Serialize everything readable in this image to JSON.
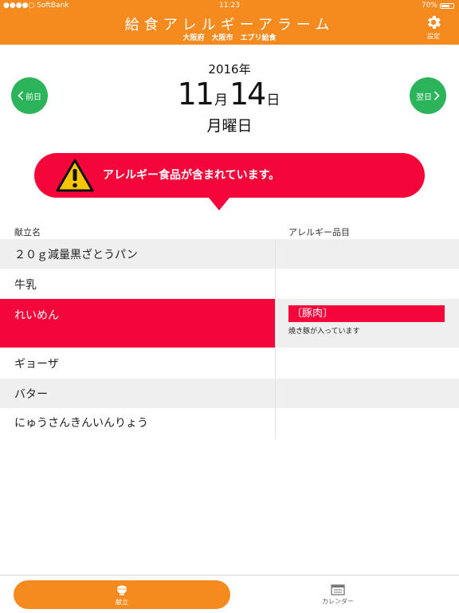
{
  "status_bar": {
    "carrier": "●●●●○ SoftBank",
    "time": "11:23",
    "battery": "70%",
    "battery_level": 0.7
  },
  "header": {
    "title": "給食アレルギーアラーム",
    "subtitle": "大阪府　大阪市　エブリ給食",
    "settings_label": "設定",
    "background": "#f58a1f"
  },
  "date": {
    "year": "2016年",
    "month": "11",
    "month_unit": "月",
    "day": "14",
    "day_unit": "日",
    "weekday": "月曜日",
    "prev_label": "前日",
    "next_label": "翌日",
    "nav_color": "#2bb45a"
  },
  "alert": {
    "message": "アレルギー食品が含まれています。",
    "color": "#f5063a"
  },
  "table": {
    "menu_header": "献立名",
    "allergy_header": "アレルギー品目",
    "rows": [
      {
        "menu": "２０ｇ減量黒ざとうパン",
        "allergy_tag": "",
        "allergy_note": ""
      },
      {
        "menu": "牛乳",
        "allergy_tag": "",
        "allergy_note": ""
      },
      {
        "menu": "れいめん",
        "allergy_tag": "〔豚肉〕",
        "allergy_note": "焼き豚が入っています"
      },
      {
        "menu": "ギョーザ",
        "allergy_tag": "",
        "allergy_note": ""
      },
      {
        "menu": "バター",
        "allergy_tag": "",
        "allergy_note": ""
      },
      {
        "menu": "にゅうさんきんいんりょう",
        "allergy_tag": "",
        "allergy_note": ""
      }
    ]
  },
  "tab_bar": {
    "menu_label": "献立",
    "calendar_label": "カレンダー"
  },
  "icons": [
    "gear-icon",
    "chevron-left-icon",
    "chevron-right-icon",
    "warning-icon",
    "rice-bowl-icon",
    "calendar-icon",
    "wifi-icon",
    "battery-icon"
  ]
}
